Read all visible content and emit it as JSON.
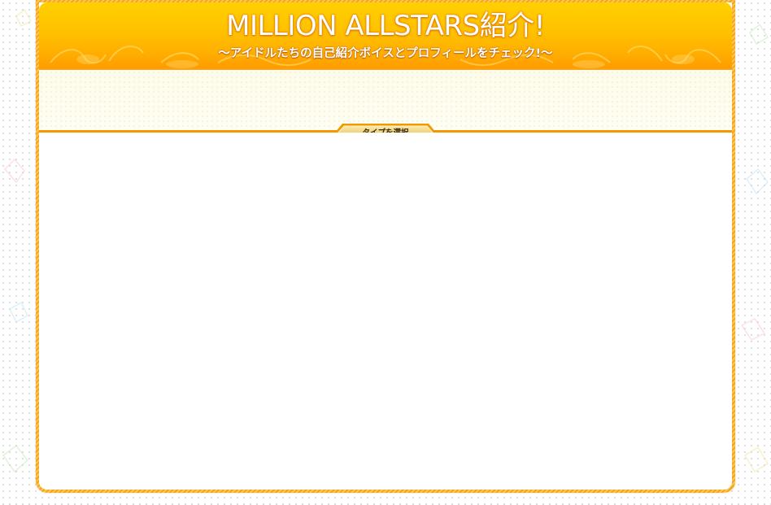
{
  "header": {
    "title": "MILLION ALLSTARS紹介!",
    "subtitle": "〜アイドルたちの自己紹介ボイスとプロフィールをチェック!〜"
  },
  "filter": {
    "type_select_label": "タイプを選択"
  },
  "colors": {
    "frame_orange": "#f7a41d",
    "header_top": "#ffd000",
    "header_bottom": "#ff9c00",
    "divider": "#f39800",
    "button_gold": "#e9c46a"
  }
}
